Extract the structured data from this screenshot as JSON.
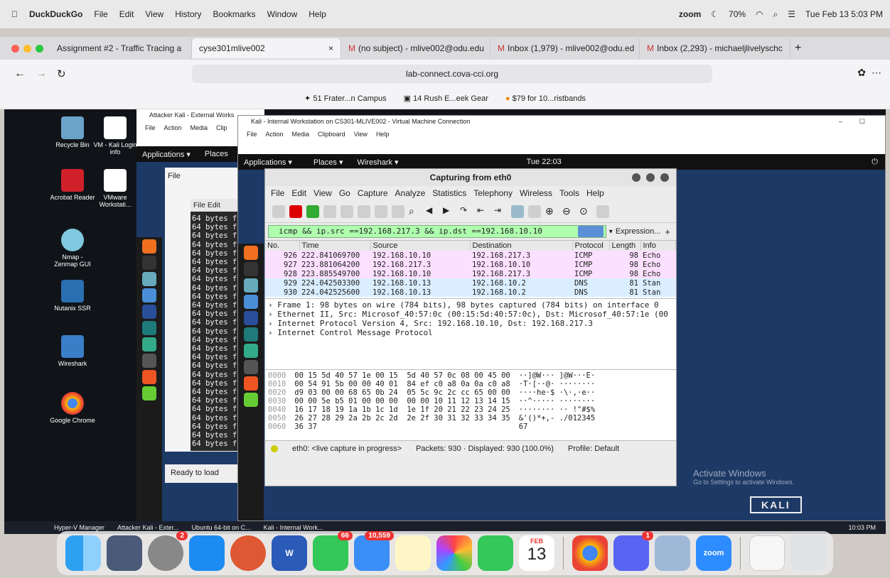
{
  "mac_menu": {
    "app": "DuckDuckGo",
    "items": [
      "File",
      "Edit",
      "View",
      "History",
      "Bookmarks",
      "Window",
      "Help"
    ],
    "zoom": "zoom",
    "battery": "70%",
    "datetime": "Tue Feb 13  5:03 PM"
  },
  "browser": {
    "tabs": [
      "Assignment #2 - Traffic Tracing a",
      "cyse301mlive002",
      "(no subject) - mlive002@odu.edu",
      "Inbox (1,979) - mlive002@odu.ed",
      "Inbox (2,293) - michaeljlivelyschc"
    ],
    "url": "lab-connect.cova-cci.org",
    "bookmarks": [
      "51 Frater...n Campus",
      "14 Rush E...eek Gear",
      "$79 for 10...ristbands"
    ]
  },
  "desktop_icons": [
    "Recycle Bin",
    "VM - Kali Login info",
    "Acrobat Reader",
    "VMware Workstati...",
    "Nmap - Zenmap GUI",
    "Nutanix SSR",
    "Wireshark",
    "Google Chrome"
  ],
  "vm_outer": {
    "title": "Attacker Kali - External Works",
    "menu": [
      "File",
      "Action",
      "Media",
      "Clip"
    ],
    "apps": "Applications ▾",
    "places": "Places",
    "term_menu": [
      "File",
      "Edit"
    ],
    "term_line": "64 bytes f",
    "ready": "Ready to load"
  },
  "vm_inner": {
    "title": "Kali - Internal Workstation on CS301-MLIVE002 - Virtual Machine Connection",
    "menu": [
      "File",
      "Action",
      "Media",
      "Clipboard",
      "View",
      "Help"
    ],
    "kali": {
      "apps": "Applications ▾",
      "places": "Places ▾",
      "wireshark": "Wireshark ▾",
      "clock": "Tue 22:03"
    }
  },
  "wireshark": {
    "title": "Capturing from eth0",
    "menu": [
      "File",
      "Edit",
      "View",
      "Go",
      "Capture",
      "Analyze",
      "Statistics",
      "Telephony",
      "Wireless",
      "Tools",
      "Help"
    ],
    "filter": "icmp && ip.src ==192.168.217.3 && ip.dst ==192.168.10.10",
    "expression": "Expression...",
    "columns": [
      "No.",
      "Time",
      "Source",
      "Destination",
      "Protocol",
      "Length",
      "Info"
    ],
    "packets": [
      {
        "no": "926",
        "time": "222.841069700",
        "src": "192.168.10.10",
        "dst": "192.168.217.3",
        "proto": "ICMP",
        "len": "98",
        "info": "Echo",
        "type": "icmp"
      },
      {
        "no": "927",
        "time": "223.881064200",
        "src": "192.168.217.3",
        "dst": "192.168.10.10",
        "proto": "ICMP",
        "len": "98",
        "info": "Echo",
        "type": "icmp"
      },
      {
        "no": "928",
        "time": "223.885549700",
        "src": "192.168.10.10",
        "dst": "192.168.217.3",
        "proto": "ICMP",
        "len": "98",
        "info": "Echo",
        "type": "icmp"
      },
      {
        "no": "929",
        "time": "224.042503300",
        "src": "192.168.10.13",
        "dst": "192.168.10.2",
        "proto": "DNS",
        "len": "81",
        "info": "Stan",
        "type": "dns"
      },
      {
        "no": "930",
        "time": "224.042525600",
        "src": "192.168.10.13",
        "dst": "192.168.10.2",
        "proto": "DNS",
        "len": "81",
        "info": "Stan",
        "type": "dns"
      }
    ],
    "details": [
      "Frame 1: 98 bytes on wire (784 bits), 98 bytes captured (784 bits) on interface 0",
      "Ethernet II, Src: Microsof_40:57:0c (00:15:5d:40:57:0c), Dst: Microsof_40:57:1e (00",
      "Internet Protocol Version 4, Src: 192.168.10.10, Dst: 192.168.217.3",
      "Internet Control Message Protocol"
    ],
    "hex": [
      {
        "off": "0000",
        "hex": "00 15 5d 40 57 1e 00 15  5d 40 57 0c 08 00 45 00",
        "ascii": "··]@W··· ]@W···E·"
      },
      {
        "off": "0010",
        "hex": "00 54 91 5b 00 00 40 01  84 ef c0 a8 0a 0a c0 a8",
        "ascii": "·T·[··@· ········"
      },
      {
        "off": "0020",
        "hex": "d9 03 00 00 68 65 0b 24  05 5c 9c 2c cc 65 00 00",
        "ascii": "····he·$ ·\\·,·e··"
      },
      {
        "off": "0030",
        "hex": "00 00 5e b5 01 00 00 00  00 00 10 11 12 13 14 15",
        "ascii": "··^····· ········"
      },
      {
        "off": "0040",
        "hex": "16 17 18 19 1a 1b 1c 1d  1e 1f 20 21 22 23 24 25",
        "ascii": "········ ·· !\"#$%"
      },
      {
        "off": "0050",
        "hex": "26 27 28 29 2a 2b 2c 2d  2e 2f 30 31 32 33 34 35",
        "ascii": "&'()*+,- ./012345"
      },
      {
        "off": "0060",
        "hex": "36 37",
        "ascii": "67"
      }
    ],
    "status": {
      "iface": "eth0: <live capture in progress>",
      "packets": "Packets: 930 · Displayed: 930 (100.0%)",
      "profile": "Profile: Default"
    }
  },
  "watermark": {
    "line1": "Activate Windows",
    "line2": "Go to Settings to activate Windows.",
    "kali": "KALI"
  },
  "taskbar": {
    "items": [
      "Hyper-V Manager",
      "Attacker Kali - Exter...",
      "Ubuntu 64-bit on C...",
      "Kali - Internal Work..."
    ],
    "time": "10:03 PM"
  },
  "dock": {
    "badges": {
      "settings": "2",
      "messages": "66",
      "mail": "10,559",
      "discord": "1"
    },
    "cal_month": "FEB",
    "cal_day": "13",
    "zoom": "zoom"
  }
}
